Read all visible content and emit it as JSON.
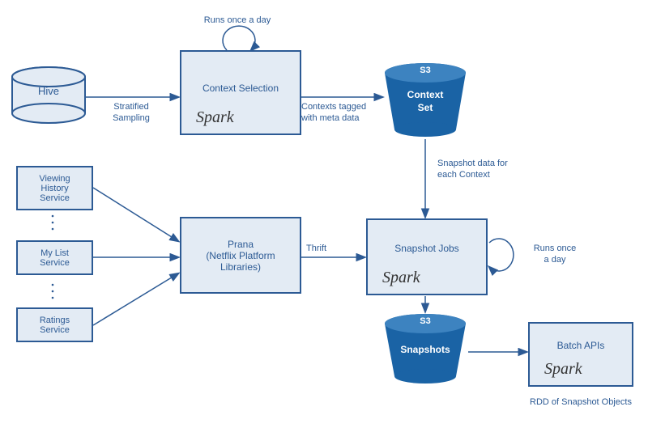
{
  "hive": {
    "label": "Hive"
  },
  "contextSelection": {
    "label": "Context Selection"
  },
  "contextSet": {
    "s3": "S3",
    "label": "Context\nSet"
  },
  "snapshots": {
    "s3": "S3",
    "label": "Snapshots"
  },
  "viewingHistory": {
    "label": "Viewing\nHistory\nService"
  },
  "myList": {
    "label": "My List\nService"
  },
  "ratings": {
    "label": "Ratings\nService"
  },
  "prana": {
    "label": "Prana\n(Netflix Platform\nLibraries)"
  },
  "snapshotJobs": {
    "label": "Snapshot Jobs"
  },
  "batchApis": {
    "label": "Batch APIs"
  },
  "edges": {
    "stratified": "Stratified\nSampling",
    "runsDayTop": "Runs once a day",
    "contextsTagged": "Contexts tagged\nwith meta data",
    "snapshotData": "Snapshot data for\neach Context",
    "thrift": "Thrift",
    "runsDayRight": "Runs once\na day",
    "rddCaption": "RDD of Snapshot Objects"
  },
  "spark": {
    "text": "Spark"
  },
  "colors": {
    "boxFill": "#e3ebf4",
    "boxBorder": "#2c5a94",
    "bucketFill": "#1a63a5",
    "bucketText": "#ffffff",
    "sparkOrange": "#f39c12"
  }
}
